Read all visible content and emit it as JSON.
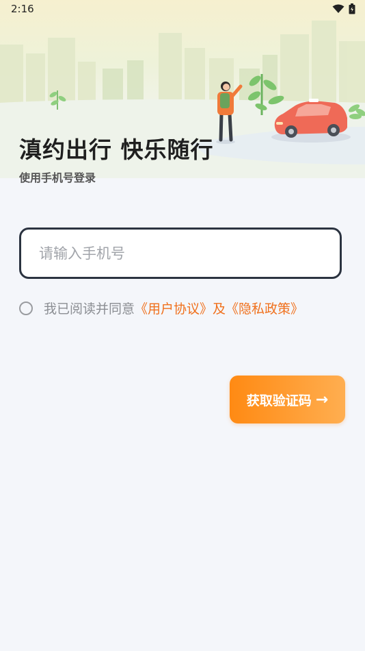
{
  "status_bar": {
    "time": "2:16",
    "icons": [
      "wifi-icon",
      "battery-icon"
    ]
  },
  "hero": {
    "title": "滇约出行 快乐随行",
    "subtitle": "使用手机号登录",
    "illustration": "city-skyline-taxi-illustration"
  },
  "login_form": {
    "phone_placeholder": "请输入手机号",
    "phone_value": ""
  },
  "agreement": {
    "checked": false,
    "prefix": "我已阅读并同意",
    "user_agreement_link": "《用户协议》",
    "connector": "及",
    "privacy_policy_link": "《隐私政策》"
  },
  "actions": {
    "get_code_label": "获取验证码",
    "get_code_arrow": "→"
  },
  "colors": {
    "accent": "#f0701c",
    "button_gradient_start": "#ff8a13",
    "button_gradient_end": "#ffae50",
    "input_border": "#2b3340",
    "background": "#f4f6fa"
  }
}
